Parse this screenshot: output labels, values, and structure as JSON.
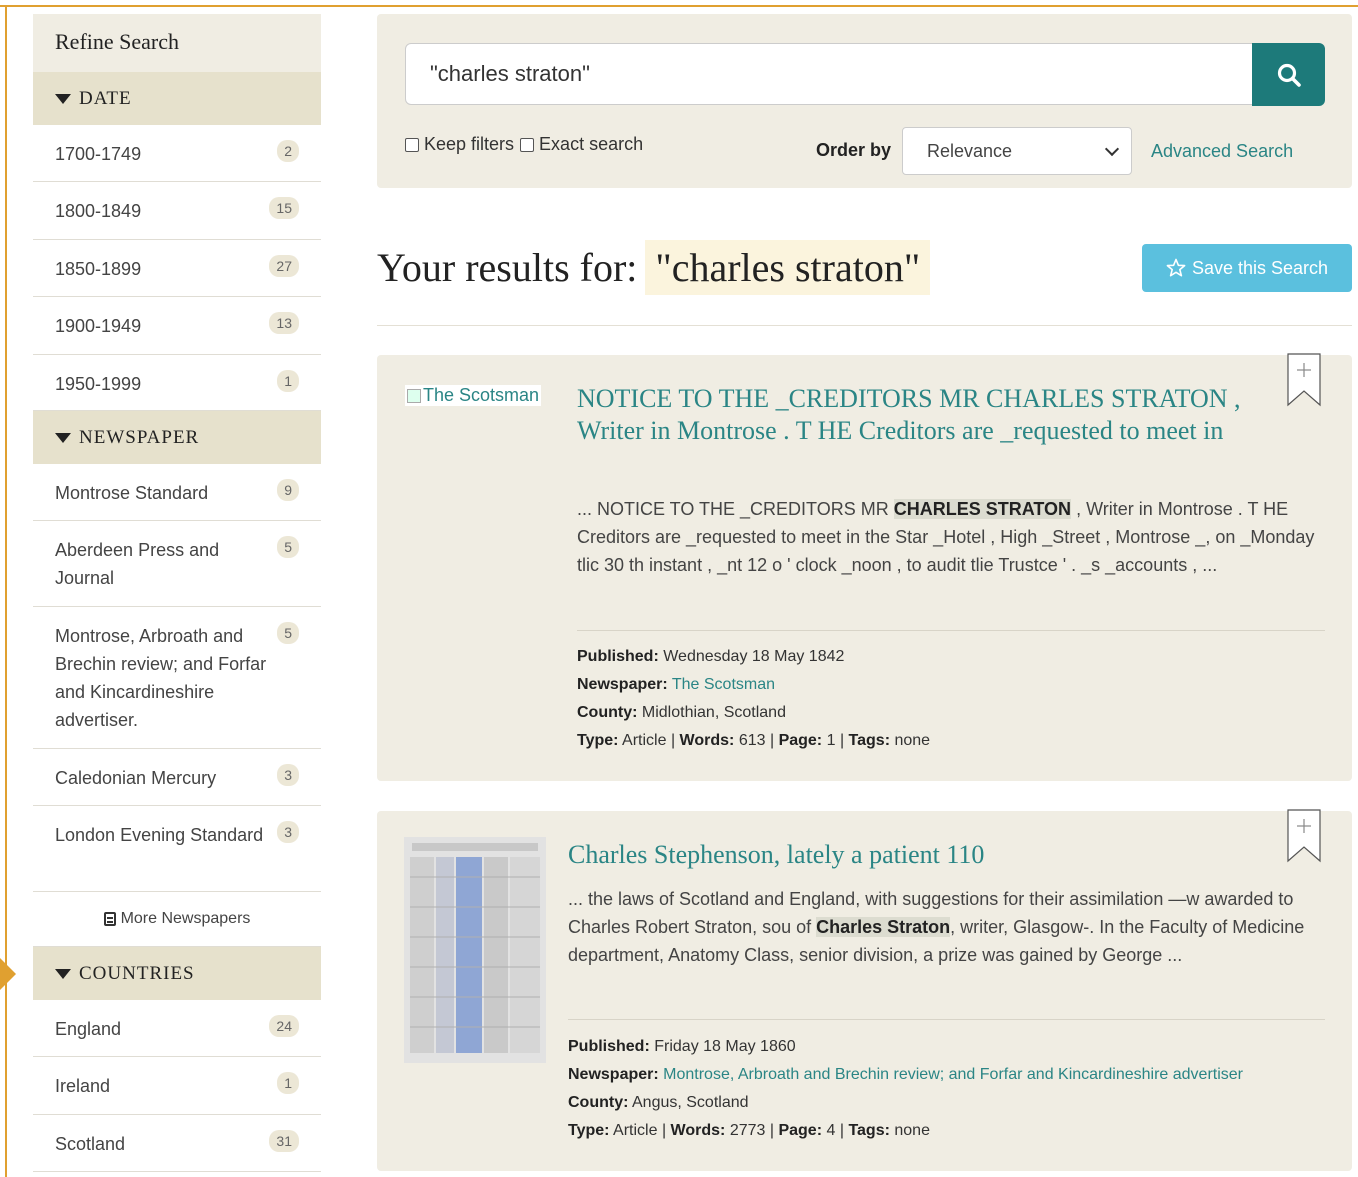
{
  "sidebar": {
    "title": "Refine Search",
    "groups": {
      "date": {
        "heading": "DATE",
        "items": [
          {
            "label": "1700-1749",
            "count": "2"
          },
          {
            "label": "1800-1849",
            "count": "15"
          },
          {
            "label": "1850-1899",
            "count": "27"
          },
          {
            "label": "1900-1949",
            "count": "13"
          },
          {
            "label": "1950-1999",
            "count": "1"
          }
        ]
      },
      "newspaper": {
        "heading": "NEWSPAPER",
        "items": [
          {
            "label": "Montrose Standard",
            "count": "9"
          },
          {
            "label": "Aberdeen Press and Journal",
            "count": "5"
          },
          {
            "label": "Montrose, Arbroath and Brechin review; and Forfar and Kincardineshire advertiser.",
            "count": "5"
          },
          {
            "label": "Caledonian Mercury",
            "count": "3"
          },
          {
            "label": "London Evening Standard",
            "count": "3"
          }
        ],
        "more": "More Newspapers"
      },
      "countries": {
        "heading": "COUNTRIES",
        "items": [
          {
            "label": "England",
            "count": "24"
          },
          {
            "label": "Ireland",
            "count": "1"
          },
          {
            "label": "Scotland",
            "count": "31"
          }
        ]
      }
    }
  },
  "search": {
    "query": "\"charles straton\"",
    "keep_filters": "Keep filters",
    "exact_search": "Exact search",
    "order_by_label": "Order by",
    "order_by_value": "Relevance",
    "advanced": "Advanced Search",
    "icon": "search-icon"
  },
  "results": {
    "heading": "Your results for:",
    "query": "\"charles straton\"",
    "save_button": "Save this Search",
    "items": [
      {
        "thumb_alt": "The Scotsman",
        "title": "NOTICE TO THE _CREDITORS MR CHARLES STRATON , Writer in Montrose . T HE Creditors are _requested to meet in",
        "snippet_pre": "... NOTICE TO THE _CREDITORS MR ",
        "snippet_hl": "CHARLES STRATON",
        "snippet_post": " , Writer in Montrose . T HE Creditors are _requested to meet in the Star _Hotel , High _Street , Montrose _, on _Monday tlic 30 th instant , _nt 12 o ' clock _noon , to audit tlie Trustce ' . _s _accounts , ...",
        "published_label": "Published:",
        "published": "Wednesday 18 May 1842",
        "newspaper_label": "Newspaper:",
        "newspaper": "The Scotsman",
        "county_label": "County:",
        "county": "Midlothian, Scotland",
        "type_label": "Type:",
        "type": "Article",
        "words_label": "Words:",
        "words": "613",
        "page_label": "Page:",
        "page": "1",
        "tags_label": "Tags:",
        "tags": "none"
      },
      {
        "title": "Charles Stephenson, lately a patient 110",
        "snippet_pre": "... the laws of Scotland and England, with suggestions for their assimilation —w awarded to Charles Robert Straton, sou of ",
        "snippet_hl": "Charles Straton",
        "snippet_post": ", writer, Glasgow-. In the Faculty of Medicine department, Anatomy Class, senior division, a prize was gained by George ...",
        "published_label": "Published:",
        "published": "Friday 18 May 1860",
        "newspaper_label": "Newspaper:",
        "newspaper": "Montrose, Arbroath and Brechin review; and Forfar and Kincardineshire advertiser",
        "county_label": "County:",
        "county": "Angus, Scotland",
        "type_label": "Type:",
        "type": "Article",
        "words_label": "Words:",
        "words": "2773",
        "page_label": "Page:",
        "page": "4",
        "tags_label": "Tags:",
        "tags": "none"
      }
    ]
  },
  "colors": {
    "accent": "#2a8585",
    "search_button": "#1d7a7a",
    "save_button": "#5bc0de",
    "panel": "#f0ede3",
    "group_heading": "#e6e1cc"
  }
}
